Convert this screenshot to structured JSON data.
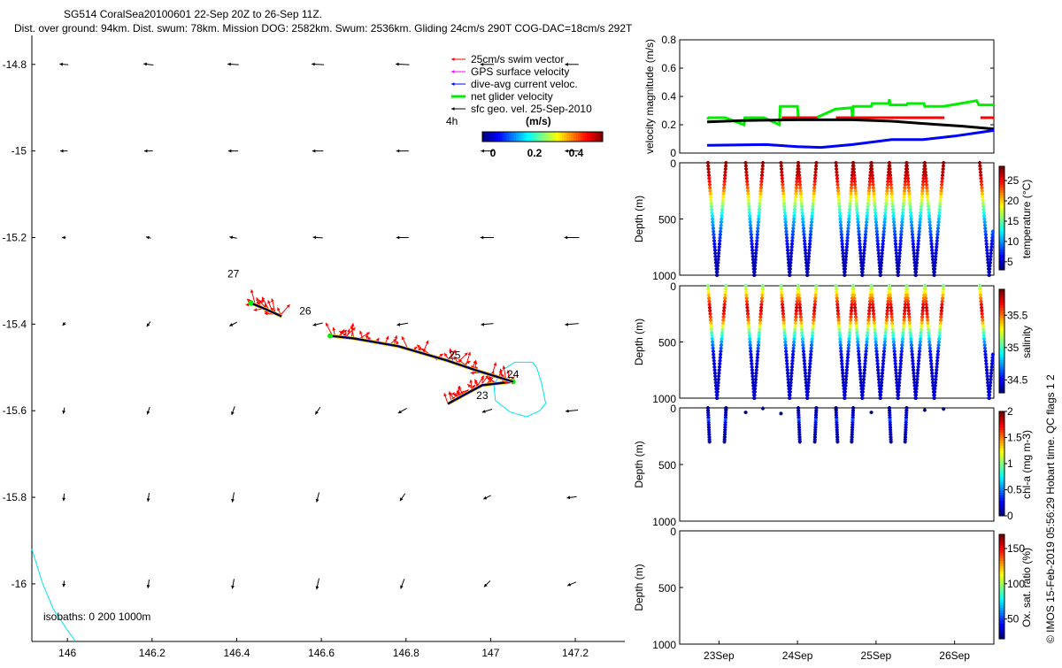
{
  "title_line1": "SG514 CoralSea20100601 22-Sep 20Z to 26-Sep 11Z.",
  "title_line2": "Dist. over ground: 94km. Dist. swum: 78km. Mission DOG: 2582km. Swum: 2536km. Gliding 24cm/s 290T COG-DAC=18cm/s 292T",
  "copyright": "© IMOS 15-Feb-2019 05:56:29 Hobart time. QC flags 1  2",
  "chart_data": [
    {
      "type": "map",
      "xlim": [
        145.916,
        147.317
      ],
      "ylim": [
        -16.133,
        -14.733
      ],
      "xticks": [
        146,
        146.2,
        146.4,
        146.6,
        146.8,
        147,
        147.2
      ],
      "xtick_labels": [
        "146",
        "146.2",
        "146.4",
        "146.6",
        "146.8",
        "147",
        "147.2"
      ],
      "yticks": [
        -14.8,
        -15,
        -15.2,
        -15.4,
        -15.6,
        -15.8,
        -16
      ],
      "ytick_labels": [
        "-14.8",
        "-15",
        "-15.2",
        "-15.4",
        "-15.6",
        "-15.8",
        "-16"
      ],
      "legend": {
        "placement": "top-right",
        "entries": [
          {
            "label": "25cm/s swim vector",
            "color": "#ff0000"
          },
          {
            "label": "GPS surface velocity",
            "color": "#ff00ff"
          },
          {
            "label": "dive-avg current veloc.",
            "color": "#0000ff"
          },
          {
            "label": "net glider velocity",
            "color": "#00ee00"
          },
          {
            "label": "sfc geo. vel. 25-Sep-2010",
            "color": "#000000"
          }
        ],
        "interval_label": "4h",
        "colorbar_title": "(m/s)",
        "colorbar_ticks": [
          "0",
          "0.2",
          "0.4"
        ],
        "colorbar_range": [
          0,
          0.5
        ]
      },
      "isobaths_label": "isobaths:  0    200   1000m",
      "sfc_geo_vectors": {
        "lons": [
          146,
          146.2,
          146.4,
          146.6,
          146.8,
          147,
          147.2
        ],
        "rows": [
          {
            "lat": -14.8,
            "uv": [
              [
                -0.14,
                0.01
              ],
              [
                -0.16,
                0.02
              ],
              [
                -0.18,
                0.01
              ],
              [
                -0.2,
                0.01
              ],
              [
                -0.22,
                0.01
              ],
              [
                -0.22,
                0
              ],
              [
                -0.22,
                0
              ]
            ]
          },
          {
            "lat": -15.0,
            "uv": [
              [
                -0.12,
                0
              ],
              [
                -0.14,
                0
              ],
              [
                -0.16,
                0
              ],
              [
                -0.18,
                0
              ],
              [
                -0.2,
                0
              ],
              [
                -0.2,
                0
              ],
              [
                -0.22,
                0
              ]
            ]
          },
          {
            "lat": -15.2,
            "uv": [
              [
                -0.06,
                0
              ],
              [
                -0.08,
                0.02
              ],
              [
                -0.12,
                0.02
              ],
              [
                -0.16,
                0.01
              ],
              [
                -0.2,
                0
              ],
              [
                -0.22,
                0
              ],
              [
                -0.24,
                0
              ]
            ]
          },
          {
            "lat": -15.4,
            "uv": [
              [
                -0.04,
                -0.05
              ],
              [
                -0.06,
                -0.08
              ],
              [
                -0.12,
                -0.06
              ],
              [
                -0.16,
                -0.04
              ],
              [
                -0.18,
                -0.03
              ],
              [
                -0.2,
                -0.02
              ],
              [
                -0.22,
                -0.02
              ]
            ]
          },
          {
            "lat": -15.6,
            "uv": [
              [
                -0.02,
                -0.1
              ],
              [
                -0.04,
                -0.12
              ],
              [
                -0.05,
                -0.14
              ],
              [
                -0.08,
                -0.12
              ],
              [
                -0.14,
                -0.08
              ],
              [
                -0.16,
                -0.05
              ],
              [
                -0.2,
                -0.02
              ]
            ]
          },
          {
            "lat": -15.8,
            "uv": [
              [
                -0.01,
                -0.12
              ],
              [
                -0.02,
                -0.14
              ],
              [
                -0.03,
                -0.16
              ],
              [
                -0.04,
                -0.16
              ],
              [
                -0.08,
                -0.12
              ],
              [
                -0.12,
                -0.06
              ],
              [
                -0.16,
                -0.02
              ]
            ]
          },
          {
            "lat": -16.0,
            "uv": [
              [
                -0.01,
                -0.1
              ],
              [
                -0.02,
                -0.14
              ],
              [
                -0.03,
                -0.16
              ],
              [
                -0.04,
                -0.18
              ],
              [
                -0.06,
                -0.16
              ],
              [
                -0.1,
                -0.1
              ],
              [
                -0.14,
                -0.06
              ]
            ]
          }
        ]
      },
      "track_segments": [
        [
          [
            146.899,
            -15.584
          ],
          [
            146.94,
            -15.562
          ],
          [
            146.98,
            -15.541
          ],
          [
            147.053,
            -15.533
          ]
        ],
        [
          [
            147.053,
            -15.533
          ],
          [
            146.97,
            -15.508
          ],
          [
            146.897,
            -15.484
          ],
          [
            146.782,
            -15.451
          ],
          [
            146.677,
            -15.433
          ],
          [
            146.621,
            -15.427
          ]
        ],
        [
          [
            146.506,
            -15.382
          ],
          [
            146.47,
            -15.366
          ],
          [
            146.433,
            -15.351
          ]
        ]
      ],
      "day_labels": [
        {
          "text": "27",
          "lon": 146.378,
          "lat": -15.292
        },
        {
          "text": "26",
          "lon": 146.548,
          "lat": -15.378
        },
        {
          "text": "25",
          "lon": 146.901,
          "lat": -15.48
        },
        {
          "text": "24",
          "lon": 147.039,
          "lat": -15.524
        },
        {
          "text": "23",
          "lon": 146.966,
          "lat": -15.573
        }
      ],
      "isobath_contour": [
        [
          147.057,
          -15.488
        ],
        [
          147.099,
          -15.488
        ],
        [
          147.109,
          -15.501
        ],
        [
          147.12,
          -15.535
        ],
        [
          147.13,
          -15.583
        ],
        [
          147.116,
          -15.6
        ],
        [
          147.085,
          -15.614
        ],
        [
          147.046,
          -15.603
        ],
        [
          147.011,
          -15.576
        ],
        [
          147.008,
          -15.542
        ],
        [
          147.025,
          -15.508
        ],
        [
          147.057,
          -15.488
        ]
      ],
      "coastline": [
        [
          145.916,
          -15.92
        ],
        [
          145.941,
          -15.998
        ],
        [
          145.967,
          -16.059
        ],
        [
          145.998,
          -16.104
        ],
        [
          146.019,
          -16.133
        ]
      ]
    },
    {
      "type": "line",
      "ylabel": "velocity magnitude (m/s)",
      "xlim": [
        22.5,
        26.5
      ],
      "ylim": [
        0,
        0.8
      ],
      "yticks": [
        "0",
        "0.2",
        "0.4",
        "0.6",
        "0.8"
      ],
      "series": [
        {
          "color": "#00ee00",
          "points": [
            [
              22.85,
              0.24
            ],
            [
              22.87,
              0.25
            ],
            [
              23.08,
              0.25
            ],
            [
              23.32,
              0.2
            ],
            [
              23.33,
              0.25
            ],
            [
              23.57,
              0.25
            ],
            [
              23.77,
              0.2
            ],
            [
              23.78,
              0.33
            ],
            [
              24.0,
              0.33
            ],
            [
              24.01,
              0.25
            ],
            [
              24.24,
              0.25
            ],
            [
              24.48,
              0.31
            ],
            [
              24.69,
              0.32
            ],
            [
              24.7,
              0.23
            ],
            [
              24.71,
              0.33
            ],
            [
              24.94,
              0.33
            ],
            [
              24.95,
              0.35
            ],
            [
              25.16,
              0.35
            ],
            [
              25.17,
              0.38
            ],
            [
              25.18,
              0.34
            ],
            [
              25.39,
              0.34
            ],
            [
              25.4,
              0.35
            ],
            [
              25.61,
              0.35
            ],
            [
              25.62,
              0.33
            ],
            [
              25.86,
              0.33
            ],
            [
              26.28,
              0.37
            ],
            [
              26.31,
              0.34
            ],
            [
              26.5,
              0.34
            ]
          ]
        },
        {
          "color": "#ff0000",
          "segments": [
            [
              [
                23.8,
                0.25
              ],
              [
                24.25,
                0.25
              ]
            ],
            [
              [
                24.49,
                0.25
              ],
              [
                25.87,
                0.25
              ]
            ],
            [
              [
                26.33,
                0.25
              ],
              [
                26.5,
                0.25
              ]
            ]
          ]
        },
        {
          "color": "#000000",
          "points": [
            [
              22.85,
              0.22
            ],
            [
              23.3,
              0.23
            ],
            [
              24.0,
              0.235
            ],
            [
              24.7,
              0.235
            ],
            [
              25.2,
              0.225
            ],
            [
              25.7,
              0.205
            ],
            [
              26.1,
              0.19
            ],
            [
              26.5,
              0.17
            ]
          ]
        },
        {
          "color": "#0000ff",
          "points": [
            [
              22.85,
              0.055
            ],
            [
              23.6,
              0.06
            ],
            [
              24.0,
              0.045
            ],
            [
              24.3,
              0.04
            ],
            [
              24.7,
              0.06
            ],
            [
              25.2,
              0.095
            ],
            [
              25.6,
              0.095
            ],
            [
              26.0,
              0.12
            ],
            [
              26.5,
              0.16
            ]
          ]
        }
      ]
    },
    {
      "type": "scatter",
      "ylabel": "Depth (m)",
      "xtick_labels": [
        "23Sep",
        "24Sep",
        "25Sep",
        "26Sep"
      ],
      "xticks": [
        23,
        24,
        25,
        26
      ],
      "xlim": [
        22.5,
        26.5
      ],
      "ylim": [
        1000,
        0
      ],
      "yticks": [
        "0",
        "500",
        "1000"
      ],
      "dives": [
        [
          22.86,
          23.09
        ],
        [
          23.34,
          23.56
        ],
        [
          23.79,
          24.01
        ],
        [
          24.01,
          24.24
        ],
        [
          24.49,
          24.71
        ],
        [
          24.71,
          24.94
        ],
        [
          24.94,
          25.17
        ],
        [
          25.17,
          25.39
        ],
        [
          25.39,
          25.62
        ],
        [
          25.62,
          25.86
        ],
        [
          26.32,
          26.56
        ]
      ],
      "panels": [
        {
          "variable": "temperature",
          "clabel": "temperature (°C)",
          "crange": [
            3,
            28.5
          ],
          "cticks": [
            5,
            10,
            15,
            20,
            25
          ],
          "profile": [
            [
              0,
              28
            ],
            [
              100,
              27
            ],
            [
              200,
              24
            ],
            [
              300,
              19.5
            ],
            [
              400,
              15
            ],
            [
              500,
              11
            ],
            [
              650,
              7.5
            ],
            [
              800,
              5
            ],
            [
              1000,
              4
            ]
          ]
        },
        {
          "variable": "salinity",
          "clabel": "salinity",
          "crange": [
            34.3,
            35.9
          ],
          "cticks": [
            34.5,
            35,
            35.5
          ],
          "profile": [
            [
              0,
              35.1
            ],
            [
              80,
              35.4
            ],
            [
              200,
              35.8
            ],
            [
              300,
              35.55
            ],
            [
              400,
              35.1
            ],
            [
              500,
              34.75
            ],
            [
              600,
              34.5
            ],
            [
              800,
              34.4
            ],
            [
              1000,
              34.45
            ]
          ]
        },
        {
          "variable": "chl-a",
          "clabel": "chl-a (mg m-3)",
          "crange": [
            0,
            2
          ],
          "cticks": [
            0,
            0.5,
            1,
            1.5,
            2
          ],
          "profile_dives": [
            0,
            3,
            4,
            7
          ],
          "max_depth": 300,
          "profile": [
            [
              0,
              0.05
            ],
            [
              80,
              0.15
            ],
            [
              110,
              0.45
            ],
            [
              140,
              0.15
            ],
            [
              300,
              0.05
            ]
          ],
          "surface_points": [
            [
              23.34,
              40
            ],
            [
              23.56,
              5
            ],
            [
              23.79,
              50
            ],
            [
              24.49,
              5
            ],
            [
              24.94,
              40
            ],
            [
              25.62,
              20
            ],
            [
              25.86,
              10
            ],
            [
              23.09,
              10
            ]
          ]
        },
        {
          "variable": "oxygen saturation",
          "clabel": "Ox. sat. ratio (%)",
          "crange": [
            22,
            170
          ],
          "cticks": [
            50,
            100,
            150
          ]
        }
      ]
    }
  ]
}
